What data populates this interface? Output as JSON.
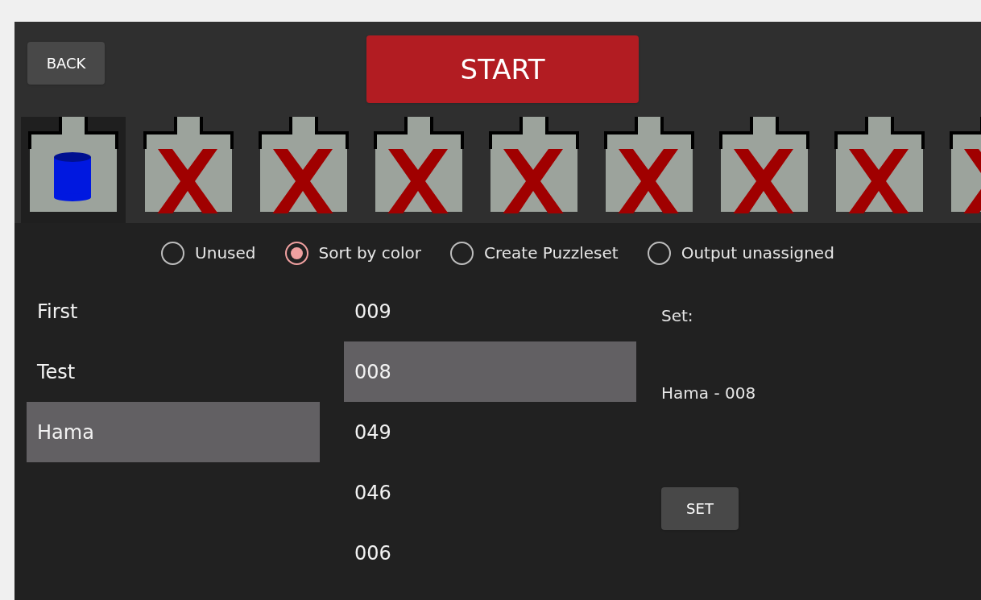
{
  "back_button": "BACK",
  "start_button": "START",
  "bins": [
    {
      "kind": "cylinder",
      "selected": true
    },
    {
      "kind": "empty",
      "selected": false
    },
    {
      "kind": "empty",
      "selected": false
    },
    {
      "kind": "empty",
      "selected": false
    },
    {
      "kind": "empty",
      "selected": false
    },
    {
      "kind": "empty",
      "selected": false
    },
    {
      "kind": "empty",
      "selected": false
    },
    {
      "kind": "empty",
      "selected": false
    },
    {
      "kind": "empty",
      "selected": false
    }
  ],
  "modes": [
    {
      "label": "Unused",
      "selected": false
    },
    {
      "label": "Sort by color",
      "selected": true
    },
    {
      "label": "Create Puzzleset",
      "selected": false
    },
    {
      "label": "Output unassigned",
      "selected": false
    }
  ],
  "sets": [
    {
      "label": "First",
      "selected": false
    },
    {
      "label": "Test",
      "selected": false
    },
    {
      "label": "Hama",
      "selected": true
    }
  ],
  "colors": [
    {
      "label": "009",
      "selected": false
    },
    {
      "label": "008",
      "selected": true
    },
    {
      "label": "049",
      "selected": false
    },
    {
      "label": "046",
      "selected": false
    },
    {
      "label": "006",
      "selected": false
    }
  ],
  "detail": {
    "heading": "Set:",
    "value": "Hama - 008",
    "button": "SET"
  }
}
